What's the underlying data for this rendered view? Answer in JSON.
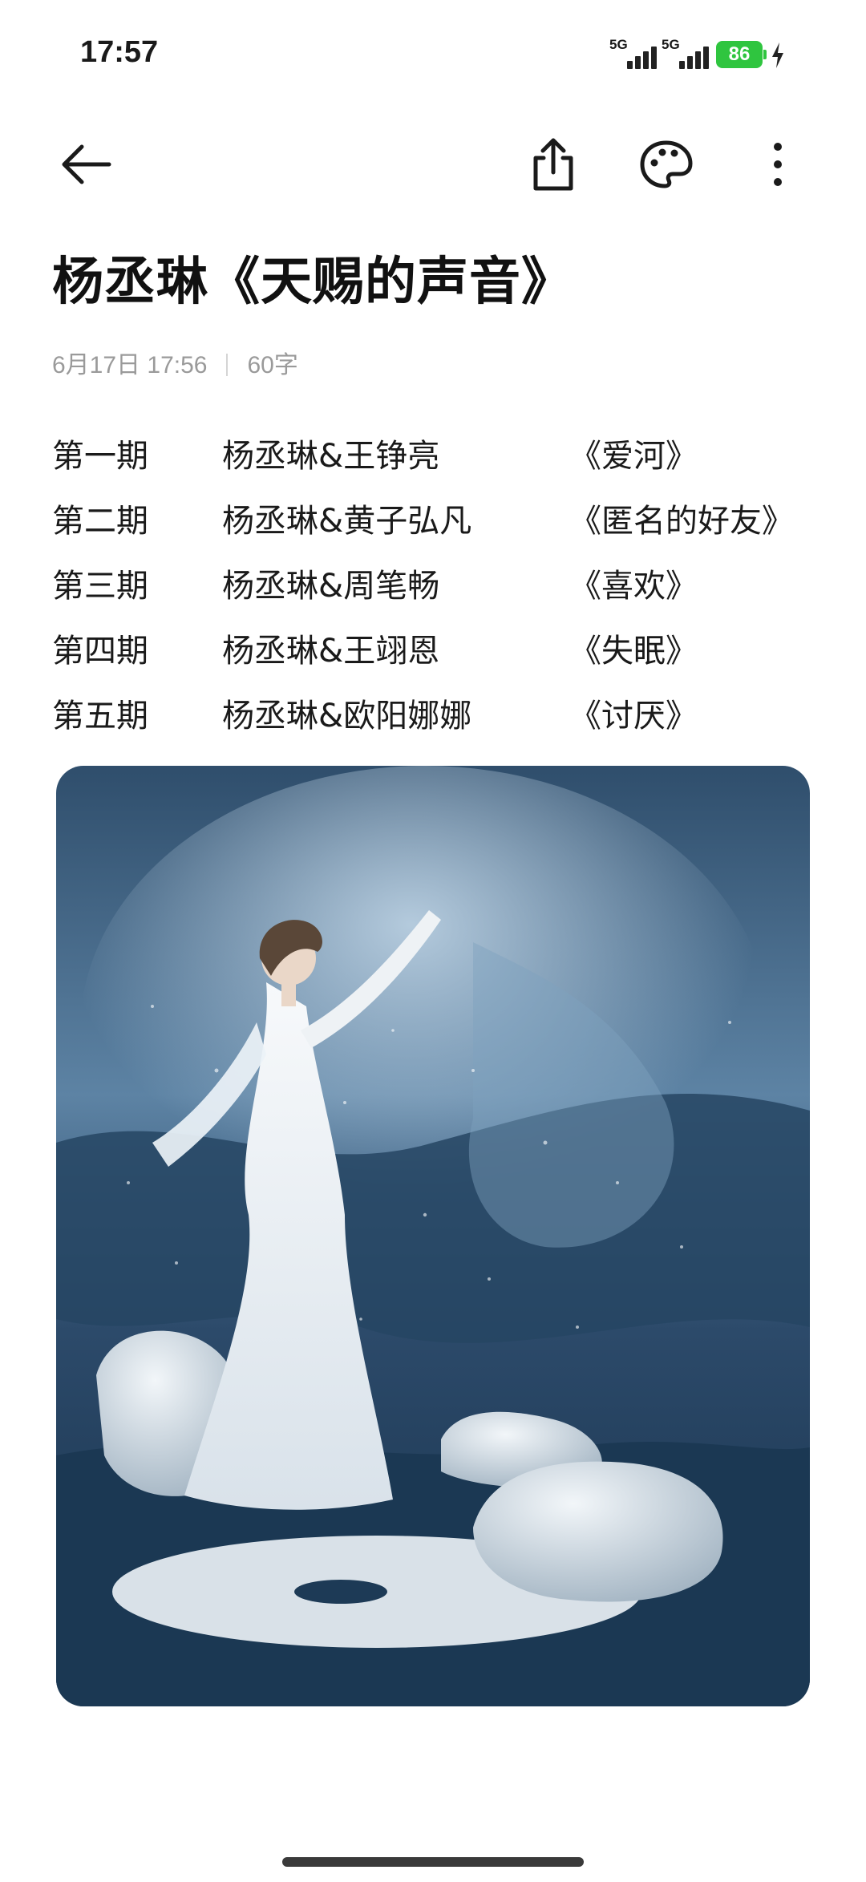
{
  "status_bar": {
    "time": "17:57",
    "signal_1_label": "5G",
    "signal_2_label": "5G",
    "battery_level": "86",
    "charging": true,
    "battery_color": "#2fc53f"
  },
  "toolbar": {
    "back_icon": "arrow-left-icon",
    "share_icon": "share-icon",
    "theme_icon": "palette-icon",
    "more_icon": "more-vertical-icon"
  },
  "note": {
    "title": "杨丞琳《天赐的声音》",
    "date": "6月17日 17:56",
    "word_count": "60字",
    "episodes": [
      {
        "num": "第一期",
        "artists": "杨丞琳&王铮亮",
        "song": "《爱河》"
      },
      {
        "num": "第二期",
        "artists": "杨丞琳&黄子弘凡",
        "song": "《匿名的好友》"
      },
      {
        "num": "第三期",
        "artists": "杨丞琳&周笔畅",
        "song": "《喜欢》"
      },
      {
        "num": "第四期",
        "artists": "杨丞琳&王翊恩",
        "song": "《失眠》"
      },
      {
        "num": "第五期",
        "artists": "杨丞琳&欧阳娜娜",
        "song": "《讨厌》"
      }
    ]
  }
}
